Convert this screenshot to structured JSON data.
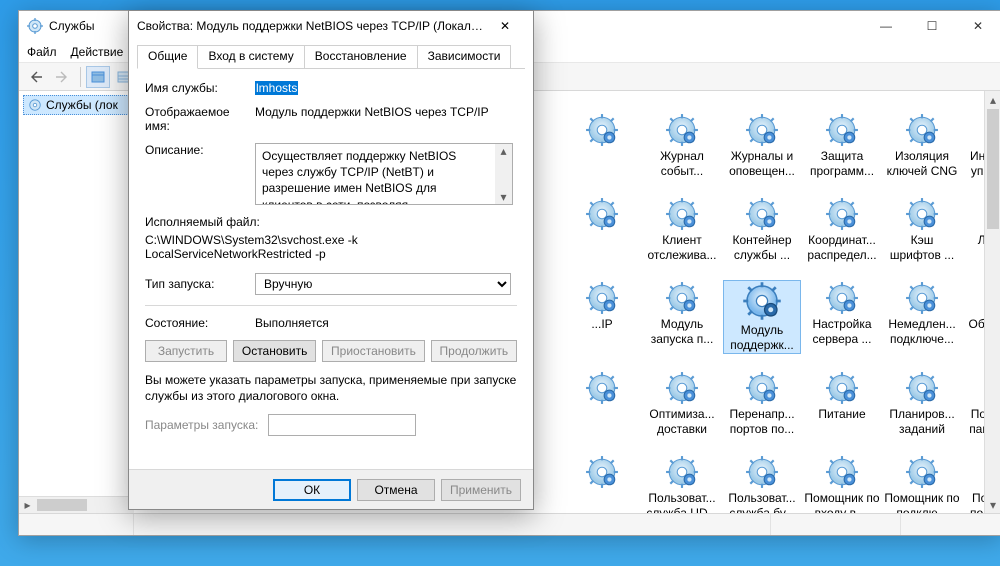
{
  "window": {
    "title": "Службы",
    "menu": [
      "Файл",
      "Действие"
    ],
    "tree_item": "Службы (лок",
    "win_min": "—",
    "win_max": "☐",
    "win_close": "✕"
  },
  "dialog": {
    "title": "Свойства: Модуль поддержки NetBIOS через TCP/IP (Локальный...",
    "close": "✕",
    "tabs": [
      "Общие",
      "Вход в систему",
      "Восстановление",
      "Зависимости"
    ],
    "lbl_service_name": "Имя службы:",
    "service_name": "lmhosts",
    "lbl_display_name": "Отображаемое имя:",
    "display_name": "Модуль поддержки NetBIOS через TCP/IP",
    "lbl_description": "Описание:",
    "description": "Осуществляет поддержку NetBIOS через службу TCP/IP (NetBT) и разрешение имен NetBIOS для клиентов в сети, позволяя пользователям получать общий доступ к",
    "lbl_exe": "Исполняемый файл:",
    "exe_path": "C:\\WINDOWS\\System32\\svchost.exe -k LocalServiceNetworkRestricted -p",
    "lbl_startup": "Тип запуска:",
    "startup_type": "Вручную",
    "lbl_state": "Состояние:",
    "state": "Выполняется",
    "btn_start": "Запустить",
    "btn_stop": "Остановить",
    "btn_pause": "Приостановить",
    "btn_resume": "Продолжить",
    "hint": "Вы можете указать параметры запуска, применяемые при запуске службы из этого диалогового окна.",
    "lbl_params": "Параметры запуска:",
    "btn_ok": "ОК",
    "btn_cancel": "Отмена",
    "btn_apply": "Применить"
  },
  "services": [
    {
      "label": ""
    },
    {
      "label": "Журнал событ..."
    },
    {
      "label": "Журналы и оповещен..."
    },
    {
      "label": "Защита программ..."
    },
    {
      "label": "Изоляция ключей CNG"
    },
    {
      "label": "Инструме... управлен..."
    },
    {
      "label": ""
    },
    {
      "label": "Клиент отслежива..."
    },
    {
      "label": "Контейнер службы ..."
    },
    {
      "label": "Координат... распредел..."
    },
    {
      "label": "Кэш шрифтов ..."
    },
    {
      "label": "Ловушка SNMP"
    },
    {
      "label": "...IP"
    },
    {
      "label": "Модуль запуска п..."
    },
    {
      "label": "Модуль поддержк...",
      "selected": true
    },
    {
      "label": "Настройка сервера ..."
    },
    {
      "label": "Немедлен... подключе..."
    },
    {
      "label": "Обнаруже... SSDP"
    },
    {
      "label": ""
    },
    {
      "label": "Оптимиза... доставки"
    },
    {
      "label": "Перенапр... портов по..."
    },
    {
      "label": "Питание"
    },
    {
      "label": "Планиров... заданий"
    },
    {
      "label": "Поддержка панели уп..."
    },
    {
      "label": ""
    },
    {
      "label": "Пользоват... служба UD..."
    },
    {
      "label": "Пользоват... служба бу..."
    },
    {
      "label": "Помощник по входу в ..."
    },
    {
      "label": "Помощник по подклю..."
    },
    {
      "label": "Посредник подключе..."
    }
  ]
}
